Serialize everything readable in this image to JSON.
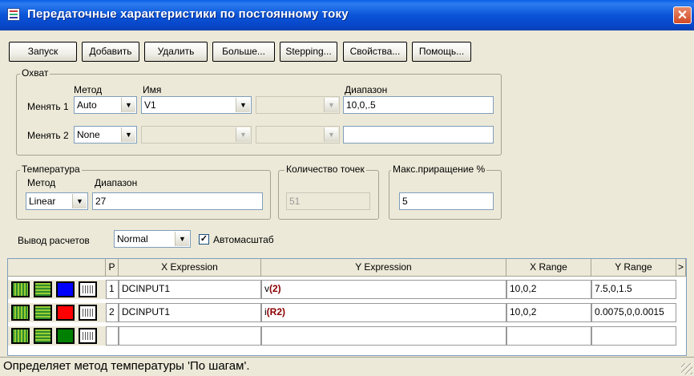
{
  "window": {
    "title": "Передаточные характеристики по постоянному току",
    "close": "✕"
  },
  "toolbar": [
    "Запуск",
    "Добавить",
    "Удалить",
    "Больше...",
    "Stepping...",
    "Свойства...",
    "Помощь..."
  ],
  "sweep": {
    "group_label": "Охват",
    "method_label": "Метод",
    "name_label": "Имя",
    "range_label": "Диапазон",
    "row1": {
      "label": "Менять 1",
      "method": "Auto",
      "name": "V1",
      "param": "",
      "range": "10,0,.5"
    },
    "row2": {
      "label": "Менять 2",
      "method": "None",
      "name": "",
      "param": "",
      "range": ""
    }
  },
  "temperature": {
    "group_label": "Температура",
    "method_label": "Метод",
    "range_label": "Диапазон",
    "method": "Linear",
    "range": "27"
  },
  "points": {
    "group_label": "Количество точек",
    "value": "51"
  },
  "maxstep": {
    "group_label": "Макс.приращение %",
    "value": "5"
  },
  "output": {
    "label": "Вывод расчетов",
    "value": "Normal",
    "autoscale_label": "Автомасштаб",
    "autoscale_checked": "✓"
  },
  "table": {
    "headers": {
      "p": "P",
      "x": "X Expression",
      "y": "Y Expression",
      "xr": "X Range",
      "yr": "Y Range",
      "more": ">"
    },
    "rows": [
      {
        "p": "1",
        "x": "DCINPUT1",
        "y_pre": "v",
        "y_arg": "(2)",
        "xr": "10,0,2",
        "yr": "7.5,0,1.5",
        "color": "#0000ff"
      },
      {
        "p": "2",
        "x": "DCINPUT1",
        "y_pre": "i",
        "y_arg": "(R2)",
        "xr": "10,0,2",
        "yr": "0.0075,0,0.0015",
        "color": "#ff0000"
      },
      {
        "p": "",
        "x": "",
        "y_pre": "",
        "y_arg": "",
        "xr": "",
        "yr": "",
        "color": "#008000"
      }
    ]
  },
  "status": {
    "text": "Определяет метод температуры 'По шагам'."
  },
  "colors": {
    "accent_red": "#8b0000"
  }
}
